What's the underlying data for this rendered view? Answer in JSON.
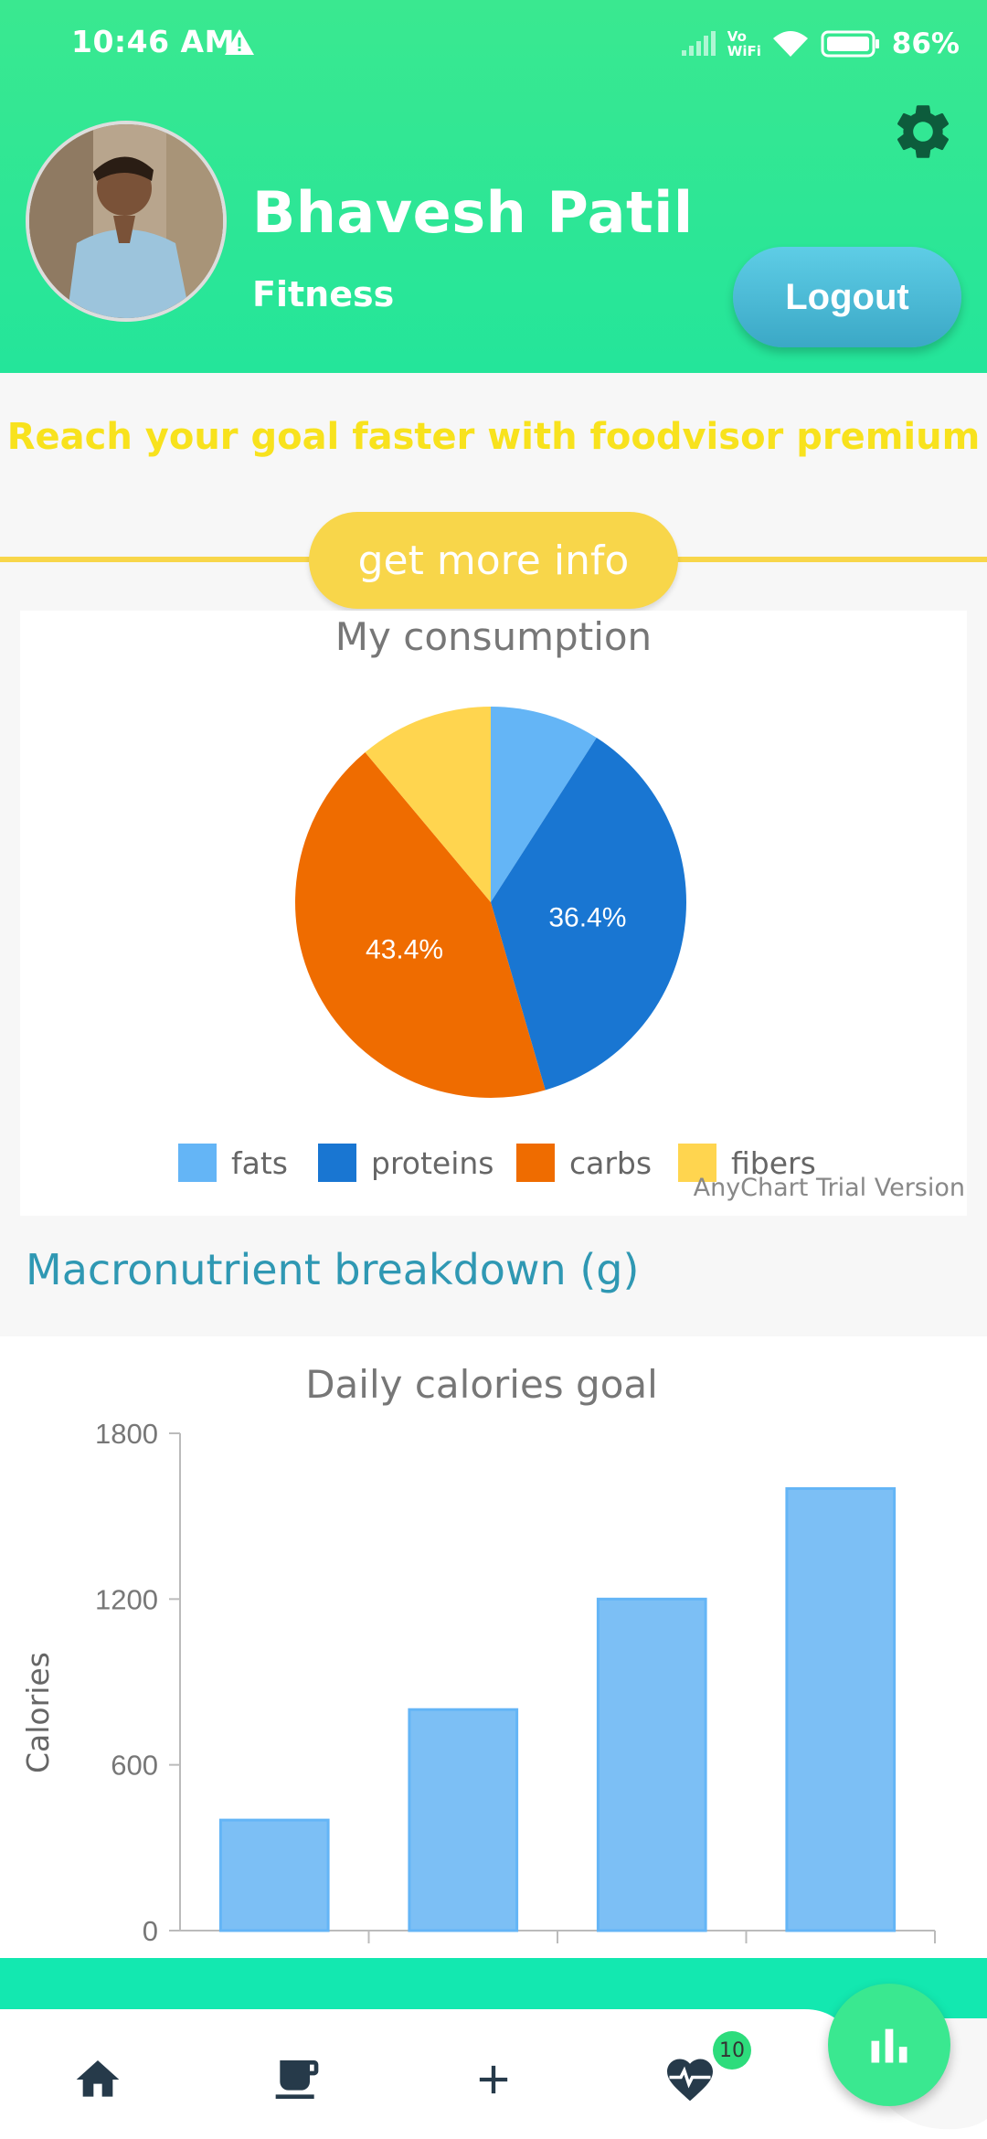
{
  "status_bar": {
    "time": "10:46 AM",
    "network": "Vo WiFi",
    "battery_text": "86%"
  },
  "profile": {
    "name": "Bhavesh Patil",
    "goal": "Fitness",
    "logout_label": "Logout"
  },
  "promo": {
    "text": "Reach your goal faster with foodvisor premium",
    "button_label": "get more info"
  },
  "colors": {
    "header_green": "#24e59a",
    "promo_yellow": "#f8d64a",
    "heading_teal": "#2f98b3",
    "fats": "#64b5f6",
    "proteins": "#1976d2",
    "carbs": "#ef6c00",
    "fibers": "#ffd54f",
    "bar": "#7cbff5"
  },
  "chart_data": [
    {
      "type": "pie",
      "title": "My consumption",
      "categories": [
        "fats",
        "proteins",
        "carbs",
        "fibers"
      ],
      "values": [
        9.1,
        36.4,
        43.4,
        11.1
      ],
      "data_labels": [
        "",
        "36.4%",
        "43.4%",
        ""
      ],
      "legend_position": "bottom",
      "watermark": "AnyChart Trial Version"
    },
    {
      "type": "bar",
      "title": "Daily calories goal",
      "categories": [
        "",
        "",
        "",
        ""
      ],
      "values": [
        400,
        800,
        1200,
        1600
      ],
      "xlabel": "",
      "ylabel": "Calories",
      "ylim": [
        0,
        1800
      ],
      "yticks": [
        "0",
        "600",
        "1200",
        "1800"
      ]
    }
  ],
  "macro_heading": "Macronutrient breakdown (g)",
  "nav": {
    "items": [
      "home-icon",
      "cup-icon",
      "plus-icon",
      "heart-pulse-icon"
    ],
    "badge_count": "10",
    "fab_icon": "bar-chart-icon"
  }
}
